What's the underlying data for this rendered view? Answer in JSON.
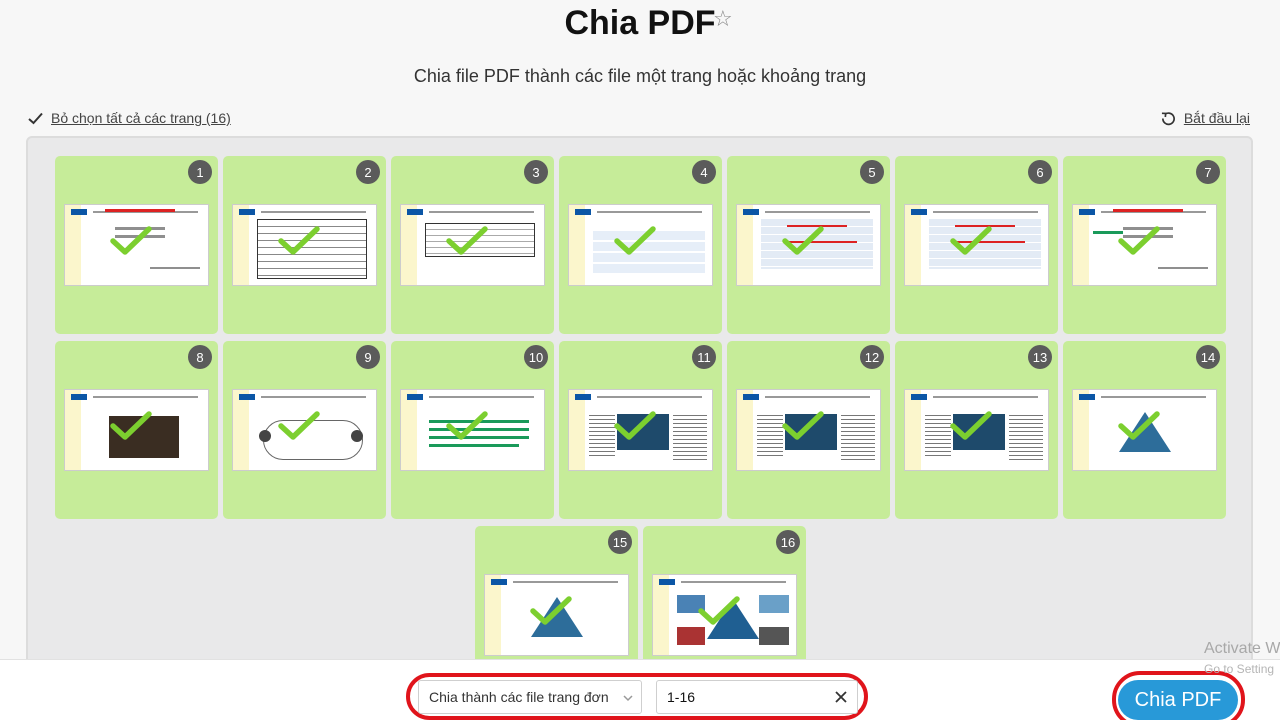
{
  "header": {
    "title": "Chia PDF",
    "subtitle": "Chia file PDF thành các file một trang hoặc khoảng trang",
    "favorite_icon": "star-icon"
  },
  "toolbar": {
    "deselect_label": "Bỏ chọn tất cả các trang (16)",
    "restart_label": "Bắt đầu lại"
  },
  "pages": [
    {
      "number": "1"
    },
    {
      "number": "2"
    },
    {
      "number": "3"
    },
    {
      "number": "4"
    },
    {
      "number": "5"
    },
    {
      "number": "6"
    },
    {
      "number": "7"
    },
    {
      "number": "8"
    },
    {
      "number": "9"
    },
    {
      "number": "10"
    },
    {
      "number": "11"
    },
    {
      "number": "12"
    },
    {
      "number": "13"
    },
    {
      "number": "14"
    },
    {
      "number": "15"
    },
    {
      "number": "16"
    }
  ],
  "footer": {
    "mode_value": "Chia thành các file trang đơn",
    "range_value": "1-16",
    "split_button": "Chia PDF"
  },
  "watermark": {
    "line1": "Activate W",
    "line2": "Go to Setting"
  },
  "colors": {
    "selected_card": "#c6ec99",
    "accent_button": "#2899d8",
    "highlight_oval": "#e0141b",
    "check": "#7ccf2f"
  }
}
